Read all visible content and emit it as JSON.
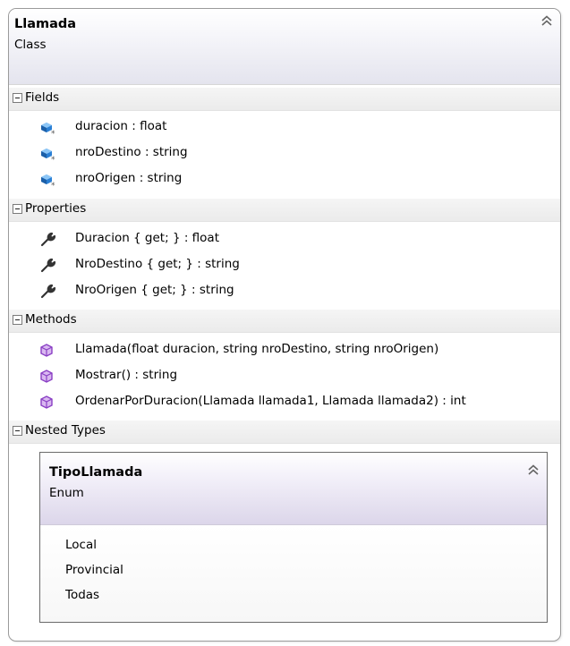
{
  "class": {
    "name": "Llamada",
    "kind": "Class",
    "sections": {
      "fields": {
        "label": "Fields",
        "items": [
          {
            "text": "duracion : float",
            "icon": "field-icon"
          },
          {
            "text": "nroDestino : string",
            "icon": "field-icon"
          },
          {
            "text": "nroOrigen : string",
            "icon": "field-icon"
          }
        ]
      },
      "properties": {
        "label": "Properties",
        "items": [
          {
            "text": "Duracion { get; } : float",
            "icon": "property-wrench-icon"
          },
          {
            "text": "NroDestino { get; } : string",
            "icon": "property-wrench-icon"
          },
          {
            "text": "NroOrigen { get; } : string",
            "icon": "property-wrench-icon"
          }
        ]
      },
      "methods": {
        "label": "Methods",
        "items": [
          {
            "text": "Llamada(float duracion, string nroDestino, string nroOrigen)",
            "icon": "method-icon"
          },
          {
            "text": "Mostrar() : string",
            "icon": "method-icon"
          },
          {
            "text": "OrdenarPorDuracion(Llamada llamada1, Llamada llamada2) : int",
            "icon": "method-icon"
          }
        ]
      },
      "nested_types": {
        "label": "Nested Types"
      }
    }
  },
  "nested": {
    "name": "TipoLlamada",
    "kind": "Enum",
    "items": [
      "Local",
      "Provincial",
      "Todas"
    ]
  },
  "colors": {
    "field_icon": "#2a7fd4",
    "method_icon": "#8a3fc4",
    "wrench": "#333333",
    "border": "#9b9b9b"
  }
}
